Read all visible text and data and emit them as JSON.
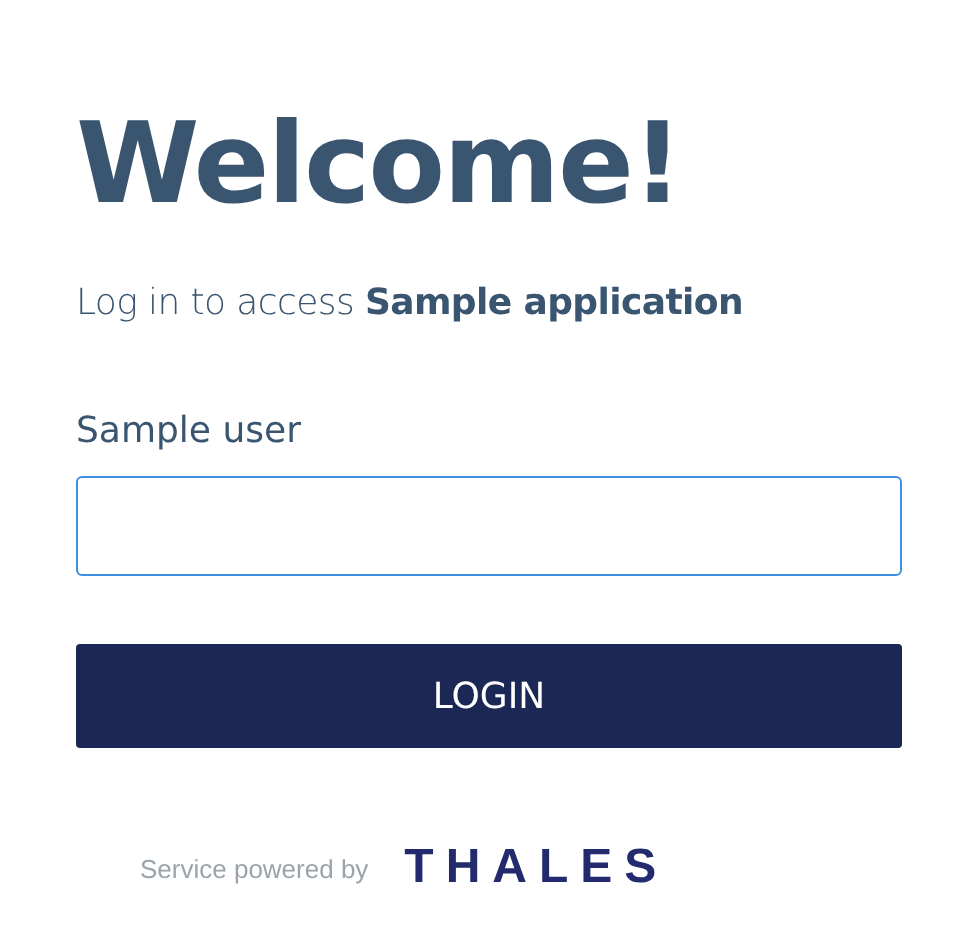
{
  "heading": "Welcome!",
  "subtitle": "Log in to access **Sample application**",
  "field": {
    "label": "Sample user",
    "focused": true
  },
  "button": "LOGIN",
  "footer": {
    "text": "Service powered by",
    "logo": "THALES"
  }
}
